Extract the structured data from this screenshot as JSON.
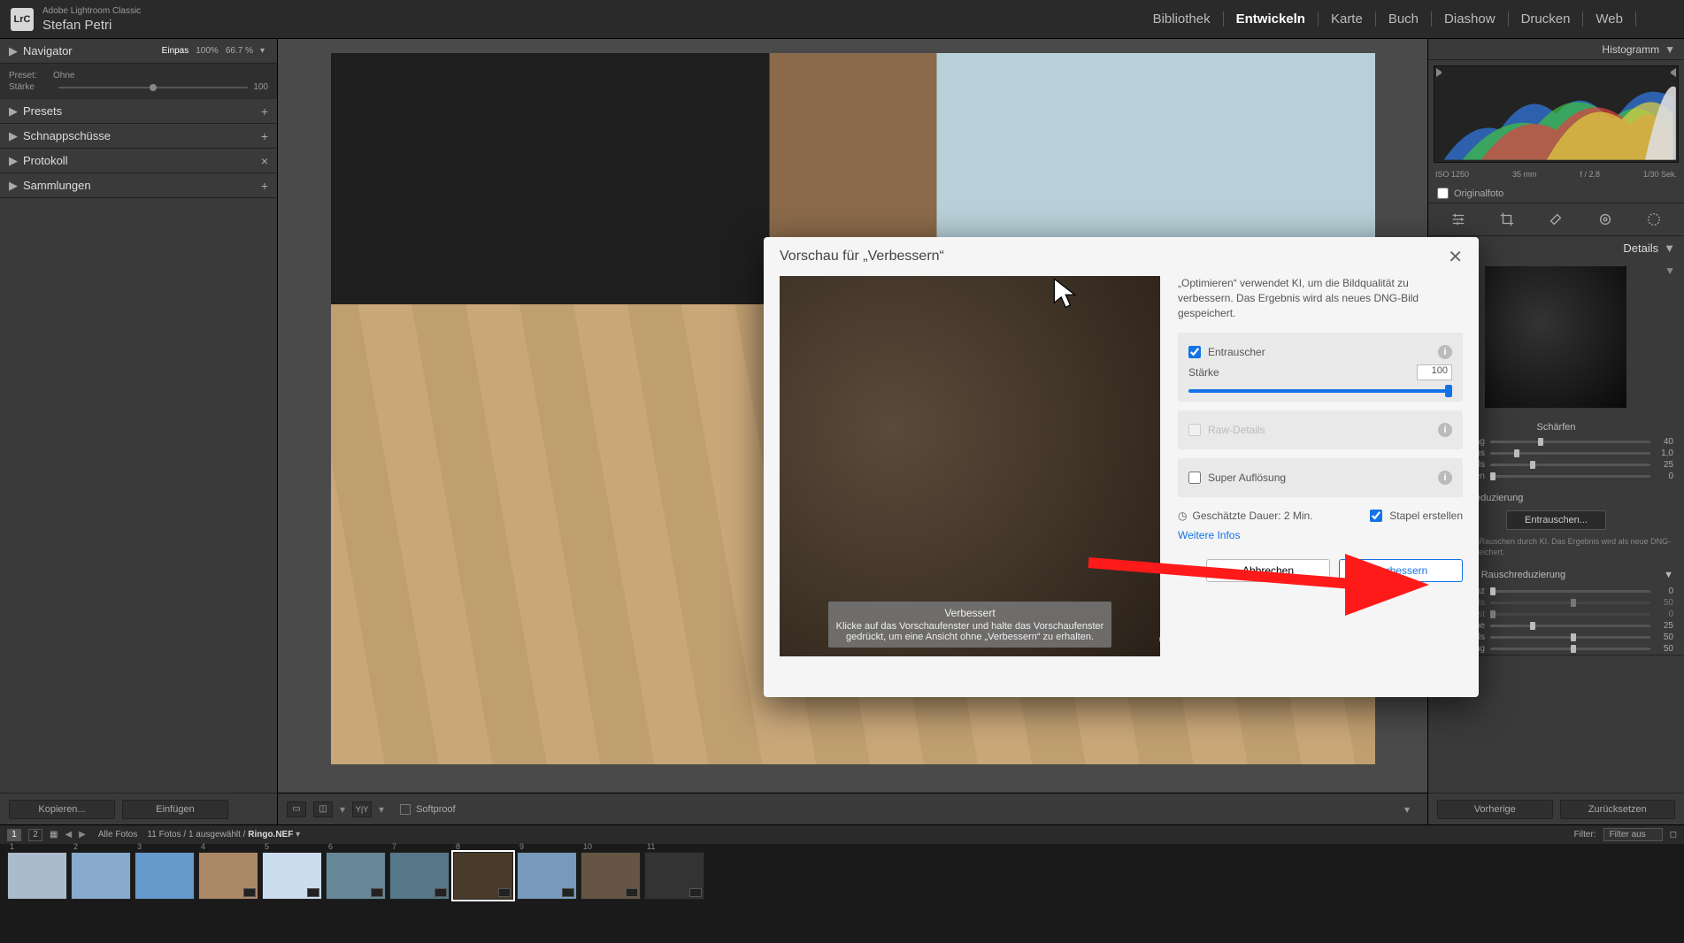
{
  "app": {
    "name": "Adobe Lightroom Classic",
    "logo": "LrC",
    "user": "Stefan Petri"
  },
  "modules": [
    "Bibliothek",
    "Entwickeln",
    "Karte",
    "Buch",
    "Diashow",
    "Drucken",
    "Web"
  ],
  "activeModule": "Entwickeln",
  "leftPanel": {
    "navigator": {
      "title": "Navigator",
      "zoom1": "Einpas",
      "zoom2": "100%",
      "zoom3": "66.7 %"
    },
    "presetBox": {
      "presetLabel": "Preset:",
      "presetValue": "Ohne",
      "strengthLabel": "Stärke",
      "strengthValue": "100"
    },
    "sections": [
      {
        "title": "Presets",
        "icon": "+"
      },
      {
        "title": "Schnappschüsse",
        "icon": "+"
      },
      {
        "title": "Protokoll",
        "icon": "×"
      },
      {
        "title": "Sammlungen",
        "icon": "+"
      }
    ],
    "buttons": {
      "copy": "Kopieren...",
      "paste": "Einfügen"
    }
  },
  "dialog": {
    "title": "Vorschau für „Verbessern“",
    "desc": "„Optimieren“ verwendet KI, um die Bildqualität zu verbessern. Das Ergebnis wird als neues DNG-Bild gespeichert.",
    "denoise": {
      "label": "Entrauscher",
      "checked": true,
      "strengthLabel": "Stärke",
      "strengthValue": "100"
    },
    "rawDetails": {
      "label": "Raw-Details",
      "checked": false
    },
    "superRes": {
      "label": "Super Auflösung",
      "checked": false
    },
    "estimate": "Geschätzte Dauer: 2 Min.",
    "stack": {
      "label": "Stapel erstellen",
      "checked": true
    },
    "moreInfo": "Weitere Infos",
    "previewLabel": "Verbessert",
    "previewHint": "Klicke auf das Vorschaufenster und halte das Vorschaufenster gedrückt, um eine Ansicht ohne „Verbessern“ zu erhalten.",
    "cancel": "Abbrechen",
    "confirm": "Verbessern"
  },
  "rightPanel": {
    "histogram": {
      "title": "Histogramm",
      "iso": "ISO 1250",
      "focal": "35 mm",
      "aperture": "f / 2,8",
      "shutter": "1/30 Sek."
    },
    "original": "Originalfoto",
    "detailsTitle": "Details",
    "sharpen": {
      "title": "Schärfen",
      "rows": [
        {
          "label": "Betrag",
          "value": "40",
          "pos": 30
        },
        {
          "label": "Radius",
          "value": "1,0",
          "pos": 15
        },
        {
          "label": "Details",
          "value": "25",
          "pos": 25
        },
        {
          "label": "Maskieren",
          "value": "0",
          "pos": 0
        }
      ]
    },
    "noiseReduction": {
      "title": "Rauschreduzierung",
      "button": "Entrauschen...",
      "desc": "Reduziere Rauschen durch KI. Das Ergebnis wird als neue DNG-Datei gespeichert."
    },
    "manualNR": {
      "title": "Manuelle Rauschreduzierung",
      "rows": [
        {
          "label": "Luminanz",
          "value": "0",
          "pos": 0,
          "dim": false
        },
        {
          "label": "Details",
          "value": "50",
          "pos": 50,
          "dim": true
        },
        {
          "label": "Kontrast",
          "value": "0",
          "pos": 0,
          "dim": true
        },
        {
          "label": "Farbe",
          "value": "25",
          "pos": 25,
          "dim": false
        },
        {
          "label": "Details",
          "value": "50",
          "pos": 50,
          "dim": false
        },
        {
          "label": "Glättung",
          "value": "50",
          "pos": 50,
          "dim": false
        }
      ]
    },
    "buttons": {
      "prev": "Vorherige",
      "reset": "Zurücksetzen"
    }
  },
  "toolbar": {
    "softproof": "Softproof"
  },
  "filmbar": {
    "pages": [
      "1",
      "2"
    ],
    "crumbs": {
      "all": "Alle Fotos",
      "count": "11 Fotos / 1 ausgewählt /",
      "file": "Ringo.NEF"
    },
    "filterLabel": "Filter:",
    "filterValue": "Filter aus"
  },
  "thumbs": [
    1,
    2,
    3,
    4,
    5,
    6,
    7,
    8,
    9,
    10,
    11
  ],
  "selectedThumb": 8
}
